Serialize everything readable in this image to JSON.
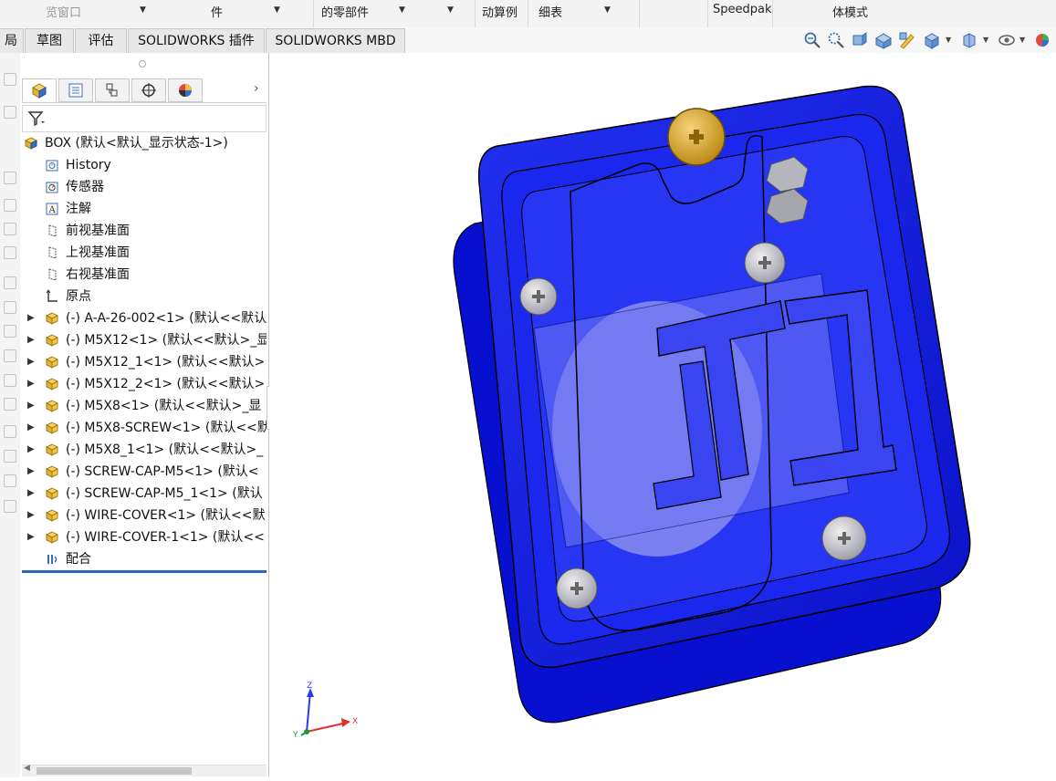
{
  "ribbon_top": {
    "items": [
      "览窗口",
      "件",
      "的零部件",
      "动算例",
      "细表",
      "Speedpak",
      "体模式"
    ]
  },
  "tabs": [
    "局",
    "草图",
    "评估",
    "SOLIDWORKS 插件",
    "SOLIDWORKS MBD"
  ],
  "tree": {
    "root": "BOX  (默认<默认_显示状态-1>)",
    "items": [
      {
        "label": "History",
        "icon": "history-icon",
        "expandable": false
      },
      {
        "label": "传感器",
        "icon": "sensor-icon",
        "expandable": false
      },
      {
        "label": "注解",
        "icon": "annotation-icon",
        "expandable": false
      },
      {
        "label": "前视基准面",
        "icon": "plane-icon",
        "expandable": false
      },
      {
        "label": "上视基准面",
        "icon": "plane-icon",
        "expandable": false
      },
      {
        "label": "右视基准面",
        "icon": "plane-icon",
        "expandable": false
      },
      {
        "label": "原点",
        "icon": "origin-icon",
        "expandable": false
      },
      {
        "label": "(-) A-A-26-002<1> (默认<<默认",
        "icon": "part-icon",
        "expandable": true
      },
      {
        "label": "(-) M5X12<1> (默认<<默认>_显",
        "icon": "part-icon",
        "expandable": true
      },
      {
        "label": "(-) M5X12_1<1> (默认<<默认>",
        "icon": "part-icon",
        "expandable": true
      },
      {
        "label": "(-) M5X12_2<1> (默认<<默认>",
        "icon": "part-icon",
        "expandable": true
      },
      {
        "label": "(-) M5X8<1> (默认<<默认>_显",
        "icon": "part-icon",
        "expandable": true
      },
      {
        "label": "(-) M5X8-SCREW<1> (默认<<默",
        "icon": "part-icon",
        "expandable": true
      },
      {
        "label": "(-) M5X8_1<1> (默认<<默认>_",
        "icon": "part-icon",
        "expandable": true
      },
      {
        "label": "(-) SCREW-CAP-M5<1> (默认<",
        "icon": "part-icon",
        "expandable": true
      },
      {
        "label": "(-) SCREW-CAP-M5_1<1> (默认",
        "icon": "part-icon",
        "expandable": true
      },
      {
        "label": "(-) WIRE-COVER<1> (默认<<默",
        "icon": "part-icon",
        "expandable": true
      },
      {
        "label": "(-) WIRE-COVER-1<1> (默认<<",
        "icon": "part-icon",
        "expandable": true
      },
      {
        "label": "配合",
        "icon": "mate-icon",
        "expandable": false
      }
    ]
  },
  "triad": {
    "x": "X",
    "y": "Y",
    "z": "Z"
  },
  "colors": {
    "model_blue": "#0b16e6",
    "screw_gold": "#d9a21f",
    "selection_line": "#2a6ab8"
  }
}
